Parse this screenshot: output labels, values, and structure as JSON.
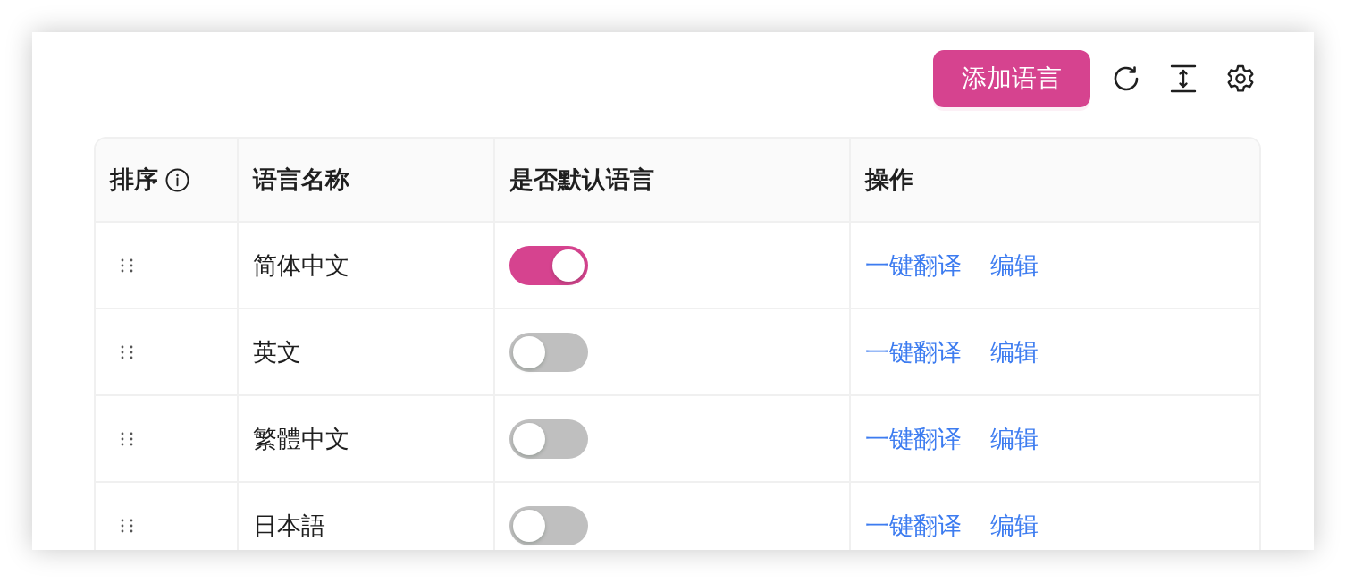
{
  "toolbar": {
    "add_button": "添加语言"
  },
  "table": {
    "columns": [
      {
        "label": "排序",
        "info": true
      },
      {
        "label": "语言名称",
        "info": false
      },
      {
        "label": "是否默认语言",
        "info": false
      },
      {
        "label": "操作",
        "info": false
      }
    ],
    "rows": [
      {
        "name": "简体中文",
        "default": true,
        "actions": [
          "一键翻译",
          "编辑"
        ]
      },
      {
        "name": "英文",
        "default": false,
        "actions": [
          "一键翻译",
          "编辑"
        ]
      },
      {
        "name": "繁體中文",
        "default": false,
        "actions": [
          "一键翻译",
          "编辑"
        ]
      },
      {
        "name": "日本語",
        "default": false,
        "actions": [
          "一键翻译",
          "编辑"
        ]
      }
    ]
  }
}
